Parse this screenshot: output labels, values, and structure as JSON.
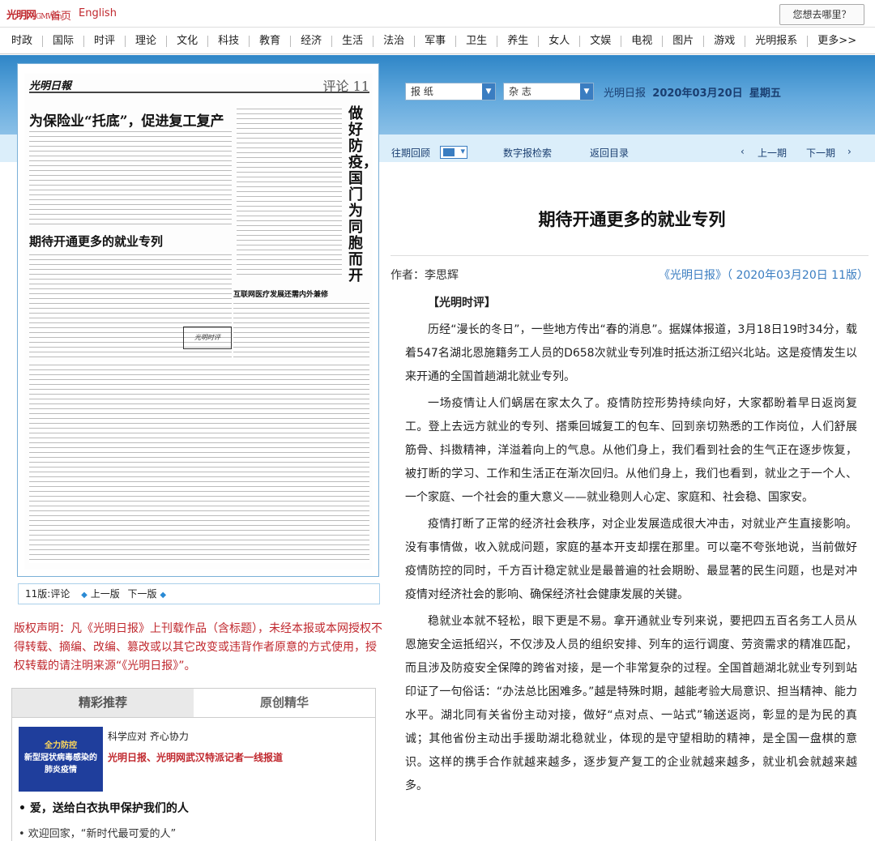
{
  "topbar": {
    "logo_text": "光明网",
    "logo_sub": "GMW.cn",
    "home": "首页",
    "english": "English",
    "where": "您想去哪里？"
  },
  "nav": [
    "时政",
    "国际",
    "时评",
    "理论",
    "文化",
    "科技",
    "教育",
    "经济",
    "生活",
    "法治",
    "军事",
    "卫生",
    "养生",
    "女人",
    "文娱",
    "电视",
    "图片",
    "游戏",
    "光明报系",
    "更多>>"
  ],
  "paper": {
    "masthead": "光明日報",
    "section": "评论  11",
    "headline1": "为保险业“托底”，促进复工复产",
    "headline2": "期待开通更多的就业专列",
    "headline3": "互联网医疗发展还需内外兼修",
    "vertical": "做好防疫，国门为同胞而开",
    "boxlabel": "光明时评",
    "footer_page": "11版:评论",
    "prev": "上一版",
    "next": "下一版"
  },
  "selectors": {
    "newspaper": "报  纸",
    "magazine": "杂  志",
    "paper_name": "光明日报",
    "date": "2020年03月20日",
    "weekday": "星期五"
  },
  "toolbar": {
    "archive": "往期回顾",
    "search": "数字报检索",
    "back": "返回目录",
    "prev_issue": "上一期",
    "next_issue": "下一期",
    "lt": "‹",
    "gt": "›"
  },
  "article": {
    "title": "期待开通更多的就业专列",
    "author": "作者：李思辉",
    "source": "《光明日报》（ 2020年03月20日   11版）",
    "tag": "【光明时评】",
    "paragraphs": [
      "历经“漫长的冬日”，一些地方传出“春的消息”。据媒体报道，3月18日19时34分，载着547名湖北恩施籍务工人员的D658次就业专列准时抵达浙江绍兴北站。这是疫情发生以来开通的全国首趟湖北就业专列。",
      "一场疫情让人们蜗居在家太久了。疫情防控形势持续向好，大家都盼着早日返岗复工。登上去远方就业的专列、搭乘回城复工的包车、回到亲切熟悉的工作岗位，人们舒展筋骨、抖擞精神，洋溢着向上的气息。从他们身上，我们看到社会的生气正在逐步恢复，被打断的学习、工作和生活正在渐次回归。从他们身上，我们也看到，就业之于一个人、一个家庭、一个社会的重大意义——就业稳则人心定、家庭和、社会稳、国家安。",
      "疫情打断了正常的经济社会秩序，对企业发展造成很大冲击，对就业产生直接影响。没有事情做，收入就成问题，家庭的基本开支却摆在那里。可以毫不夸张地说，当前做好疫情防控的同时，千方百计稳定就业是最普遍的社会期盼、最显著的民生问题，也是对冲疫情对经济社会的影响、确保经济社会健康发展的关键。",
      "稳就业本就不轻松，眼下更是不易。拿开通就业专列来说，要把四五百名务工人员从恩施安全运抵绍兴，不仅涉及人员的组织安排、列车的运行调度、劳资需求的精准匹配，而且涉及防疫安全保障的跨省对接，是一个非常复杂的过程。全国首趟湖北就业专列到站印证了一句俗话：“办法总比困难多。”越是特殊时期，越能考验大局意识、担当精神、能力水平。湖北同有关省份主动对接，做好“点对点、一站式”输送返岗，彰显的是为民的真诚；其他省份主动出手援助湖北稳就业，体现的是守望相助的精神，是全国一盘棋的意识。这样的携手合作就越来越多，逐步复产复工的企业就越来越多，就业机会就越来越多。"
    ]
  },
  "copyright": "版权声明：凡《光明日报》上刊载作品（含标题），未经本报或本网授权不得转载、摘编、改编、篡改或以其它改变或违背作者原意的方式使用，授权转载的请注明来源“《光明日报》”。",
  "recommend": {
    "tab1": "精彩推荐",
    "tab2": "原创精华",
    "thumb_line1": "全力防控",
    "thumb_line2": "新型冠状病毒感染的",
    "thumb_line3": "肺炎疫情",
    "item1_title": "科学应对 齐心协力",
    "item1_link": "光明日报、光明网武汉特派记者一线报道",
    "item2": "• 爱，送给白衣执甲保护我们的人",
    "item3": "• 欢迎回家，“新时代最可爱的人”"
  }
}
